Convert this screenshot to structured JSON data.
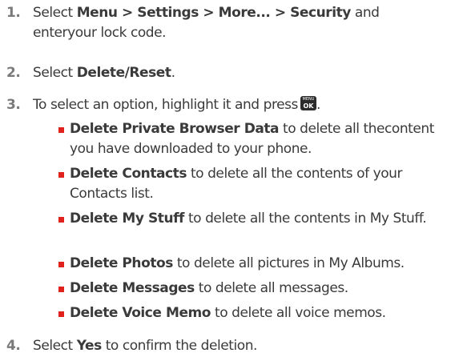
{
  "steps": [
    {
      "number": "1.",
      "before": "Select ",
      "bold": "Menu > Settings > More... > Security",
      "middle": " and",
      "line2": "enteryour lock code."
    },
    {
      "number": "2.",
      "before": "Select ",
      "bold": "Delete/Reset",
      "after": "."
    },
    {
      "number": "3.",
      "before": "To select an option, highlight it and press",
      "after": ".",
      "key": {
        "top": "MENU",
        "bottom": "OK",
        "icon": "menu-ok-key-icon"
      }
    },
    {
      "number": "4.",
      "before": "Select ",
      "bold": "Yes",
      "after": " to confirm the deletion."
    }
  ],
  "options": [
    {
      "bold": "Delete Private Browser Data",
      "rest": " to delete all thecontent you have downloaded to your phone."
    },
    {
      "bold": "Delete Contacts",
      "rest": " to delete all the contents of your Contacts list."
    },
    {
      "bold": "Delete My Stuff",
      "rest": " to delete all the contents in My Stuff."
    },
    {
      "bold": "Delete Photos",
      "rest": " to delete all pictures in My Albums."
    },
    {
      "bold": "Delete Messages",
      "rest": " to delete all messages."
    },
    {
      "bold": "Delete Voice Memo",
      "rest": " to delete all voice memos."
    }
  ],
  "colors": {
    "bullet": "#e0211c",
    "number": "#7a7a7a",
    "text": "#3a3a3a",
    "key_bg": "#2b2b2b"
  }
}
